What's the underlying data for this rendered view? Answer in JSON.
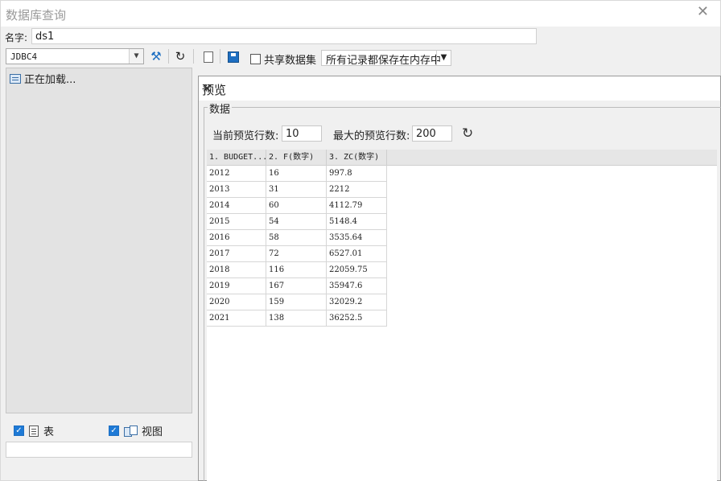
{
  "window": {
    "title": "数据库查询"
  },
  "name_row": {
    "label": "名字:",
    "value": "ds1"
  },
  "left": {
    "connection": "JDBC4",
    "tree_loading": "正在加载...",
    "check_table_label": "表",
    "check_view_label": "视图"
  },
  "toolbar": {
    "share_label": "共享数据集",
    "memory_option": "所有记录都保存在内存中"
  },
  "preview": {
    "title": "预览",
    "group_label": "数据",
    "current_rows_label": "当前预览行数:",
    "current_rows_value": "10",
    "max_rows_label": "最大的预览行数:",
    "max_rows_value": "200",
    "columns": [
      "1. BUDGET...",
      "2. F(数字)",
      "3. ZC(数字)"
    ],
    "rows": [
      [
        "2012",
        "16",
        "997.8"
      ],
      [
        "2013",
        "31",
        "2212"
      ],
      [
        "2014",
        "60",
        "4112.79"
      ],
      [
        "2015",
        "54",
        "5148.4"
      ],
      [
        "2016",
        "58",
        "3535.64"
      ],
      [
        "2017",
        "72",
        "6527.01"
      ],
      [
        "2018",
        "116",
        "22059.75"
      ],
      [
        "2019",
        "167",
        "35947.6"
      ],
      [
        "2020",
        "159",
        "32029.2"
      ],
      [
        "2021",
        "138",
        "36252.5"
      ]
    ]
  },
  "icons": {
    "close": "close-icon",
    "tools": "tools-icon",
    "refresh": "refresh-icon",
    "preview": "preview-icon",
    "save": "save-icon"
  }
}
